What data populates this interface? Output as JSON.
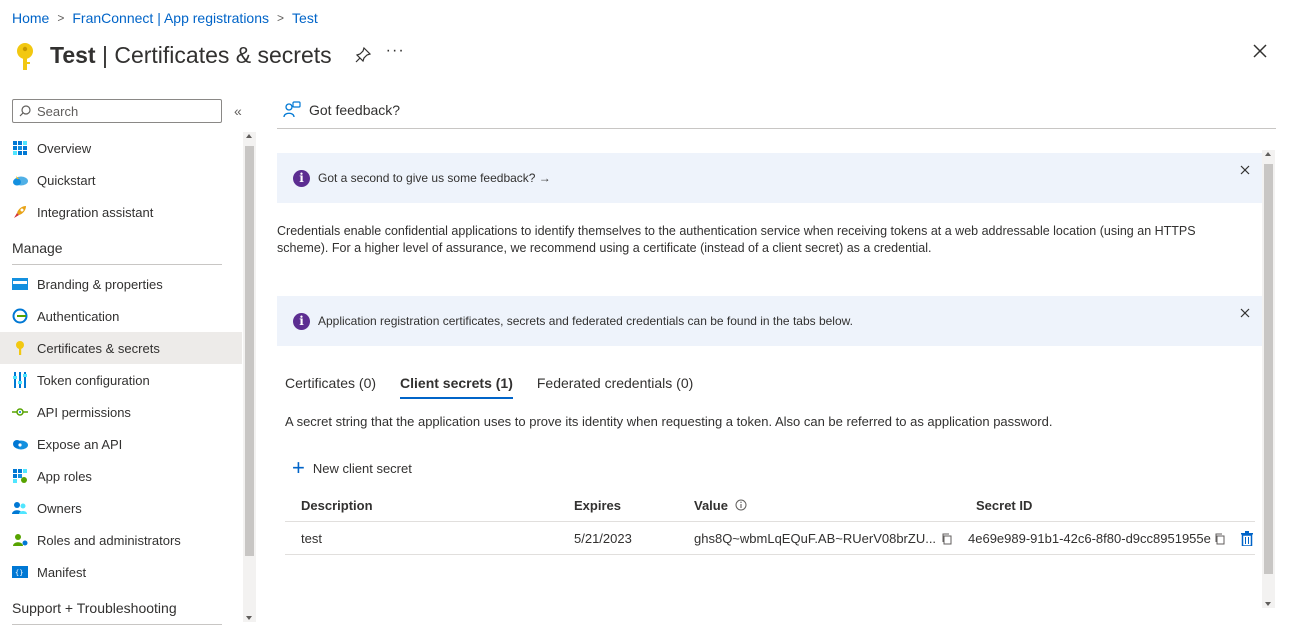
{
  "breadcrumb": {
    "items": [
      "Home",
      "FranConnect | App registrations",
      "Test"
    ]
  },
  "header": {
    "app_name": "Test",
    "separator": "|",
    "page_name": "Certificates & secrets",
    "more": "···"
  },
  "sidebar": {
    "search_placeholder": "Search",
    "collapse": "«",
    "items_top": [
      {
        "label": "Overview",
        "icon": "overview-icon"
      },
      {
        "label": "Quickstart",
        "icon": "quickstart-icon"
      },
      {
        "label": "Integration assistant",
        "icon": "rocket-icon"
      }
    ],
    "section_manage": "Manage",
    "items_manage": [
      {
        "label": "Branding & properties",
        "icon": "branding-icon"
      },
      {
        "label": "Authentication",
        "icon": "authentication-icon"
      },
      {
        "label": "Certificates & secrets",
        "icon": "key-icon",
        "active": true
      },
      {
        "label": "Token configuration",
        "icon": "token-config-icon"
      },
      {
        "label": "API permissions",
        "icon": "api-permissions-icon"
      },
      {
        "label": "Expose an API",
        "icon": "cloud-icon"
      },
      {
        "label": "App roles",
        "icon": "app-roles-icon"
      },
      {
        "label": "Owners",
        "icon": "owners-icon"
      },
      {
        "label": "Roles and administrators",
        "icon": "roles-admin-icon"
      },
      {
        "label": "Manifest",
        "icon": "manifest-icon"
      }
    ],
    "section_support": "Support + Troubleshooting"
  },
  "main": {
    "feedback_label": "Got feedback?",
    "banner1_text": "Got a second to give us some feedback? →",
    "description": "Credentials enable confidential applications to identify themselves to the authentication service when receiving tokens at a web addressable location (using an HTTPS scheme). For a higher level of assurance, we recommend using a certificate (instead of a client secret) as a credential.",
    "banner2_text": "Application registration certificates, secrets and federated credentials can be found in the tabs below.",
    "tabs": [
      {
        "label": "Certificates (0)"
      },
      {
        "label": "Client secrets (1)",
        "active": true
      },
      {
        "label": "Federated credentials (0)"
      }
    ],
    "tab_description": "A secret string that the application uses to prove its identity when requesting a token. Also can be referred to as application password.",
    "new_secret_label": "New client secret",
    "table": {
      "headers": [
        "Description",
        "Expires",
        "Value",
        "Secret ID"
      ],
      "rows": [
        {
          "description": "test",
          "expires": "5/21/2023",
          "value": "ghs8Q~wbmLqEQuF.AB~RUerV08brZU...",
          "secret_id": "4e69e989-91b1-42c6-8f80-d9cc8951955e"
        }
      ]
    }
  },
  "colors": {
    "link": "#0064c8",
    "info_banner_bg": "#eef3fb",
    "info_icon": "#5c2d91",
    "key_icon": "#f2c811",
    "active_nav_bg": "#edebe9"
  }
}
